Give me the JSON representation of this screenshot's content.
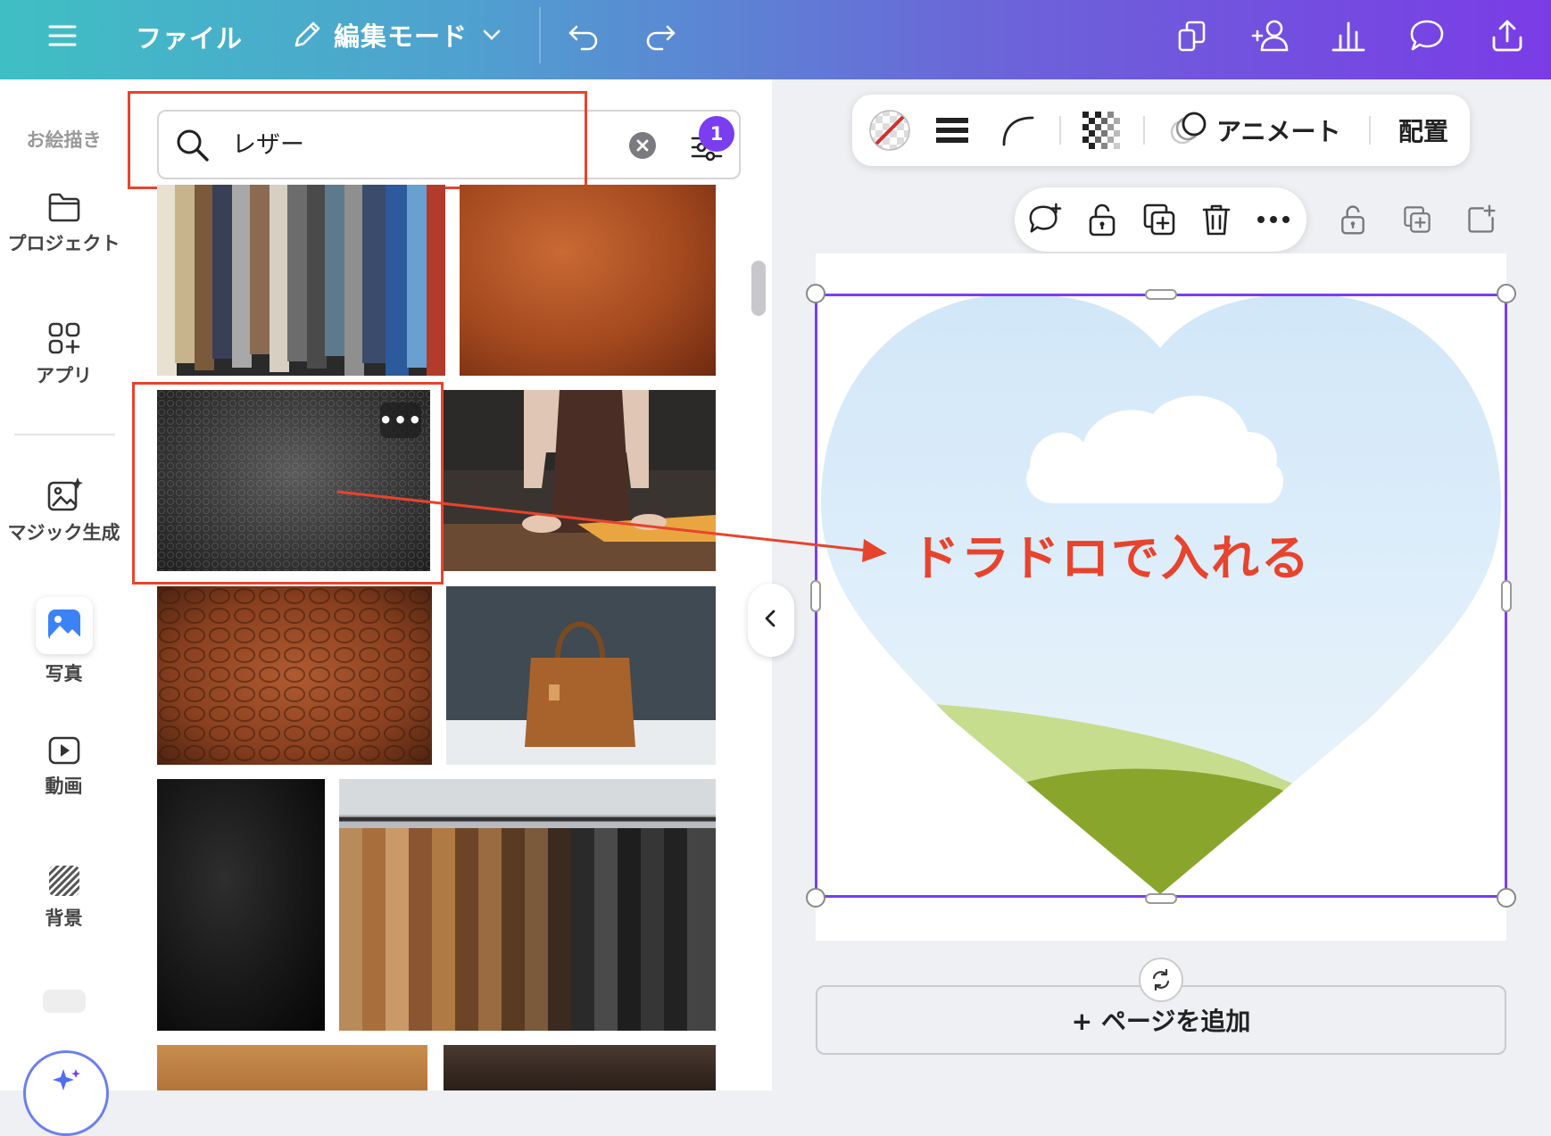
{
  "topbar": {
    "file_label": "ファイル",
    "mode_label": "編集モード",
    "icons": [
      "menu-icon",
      "pencil-icon",
      "chevron-down-icon",
      "undo-icon",
      "redo-icon",
      "resize-icon",
      "share-people-icon",
      "insights-icon",
      "comment-icon",
      "upload-icon"
    ]
  },
  "sidebar": {
    "items": [
      {
        "label": "お絵描き",
        "icon": "draw-icon"
      },
      {
        "label": "プロジェクト",
        "icon": "folder-icon"
      },
      {
        "label": "アプリ",
        "icon": "apps-icon"
      },
      {
        "label": "マジック生成",
        "icon": "magic-media-icon"
      },
      {
        "label": "写真",
        "icon": "photo-icon"
      },
      {
        "label": "動画",
        "icon": "video-icon"
      },
      {
        "label": "背景",
        "icon": "background-icon"
      }
    ]
  },
  "search": {
    "value": "レザー",
    "placeholder": "",
    "filter_count": "1"
  },
  "panel": {
    "more_label": "•••",
    "results": [
      "leather-swatches",
      "brown-leather",
      "black-leather",
      "leather-apron",
      "crocodile-leather",
      "leather-handbag",
      "dark-leather",
      "leather-jackets",
      "tan-leather",
      "leather-craft"
    ]
  },
  "toolbar": {
    "animate_label": "アニメート",
    "arrange_label": "配置"
  },
  "canvas": {
    "annotation": "ドラドロで入れる",
    "add_page_label": "+ ページを追加"
  },
  "colors": {
    "accent": "#7b3df0",
    "annotation": "#e8432d",
    "topbar_start": "#3fbfc4",
    "topbar_end": "#7a3ce6"
  }
}
